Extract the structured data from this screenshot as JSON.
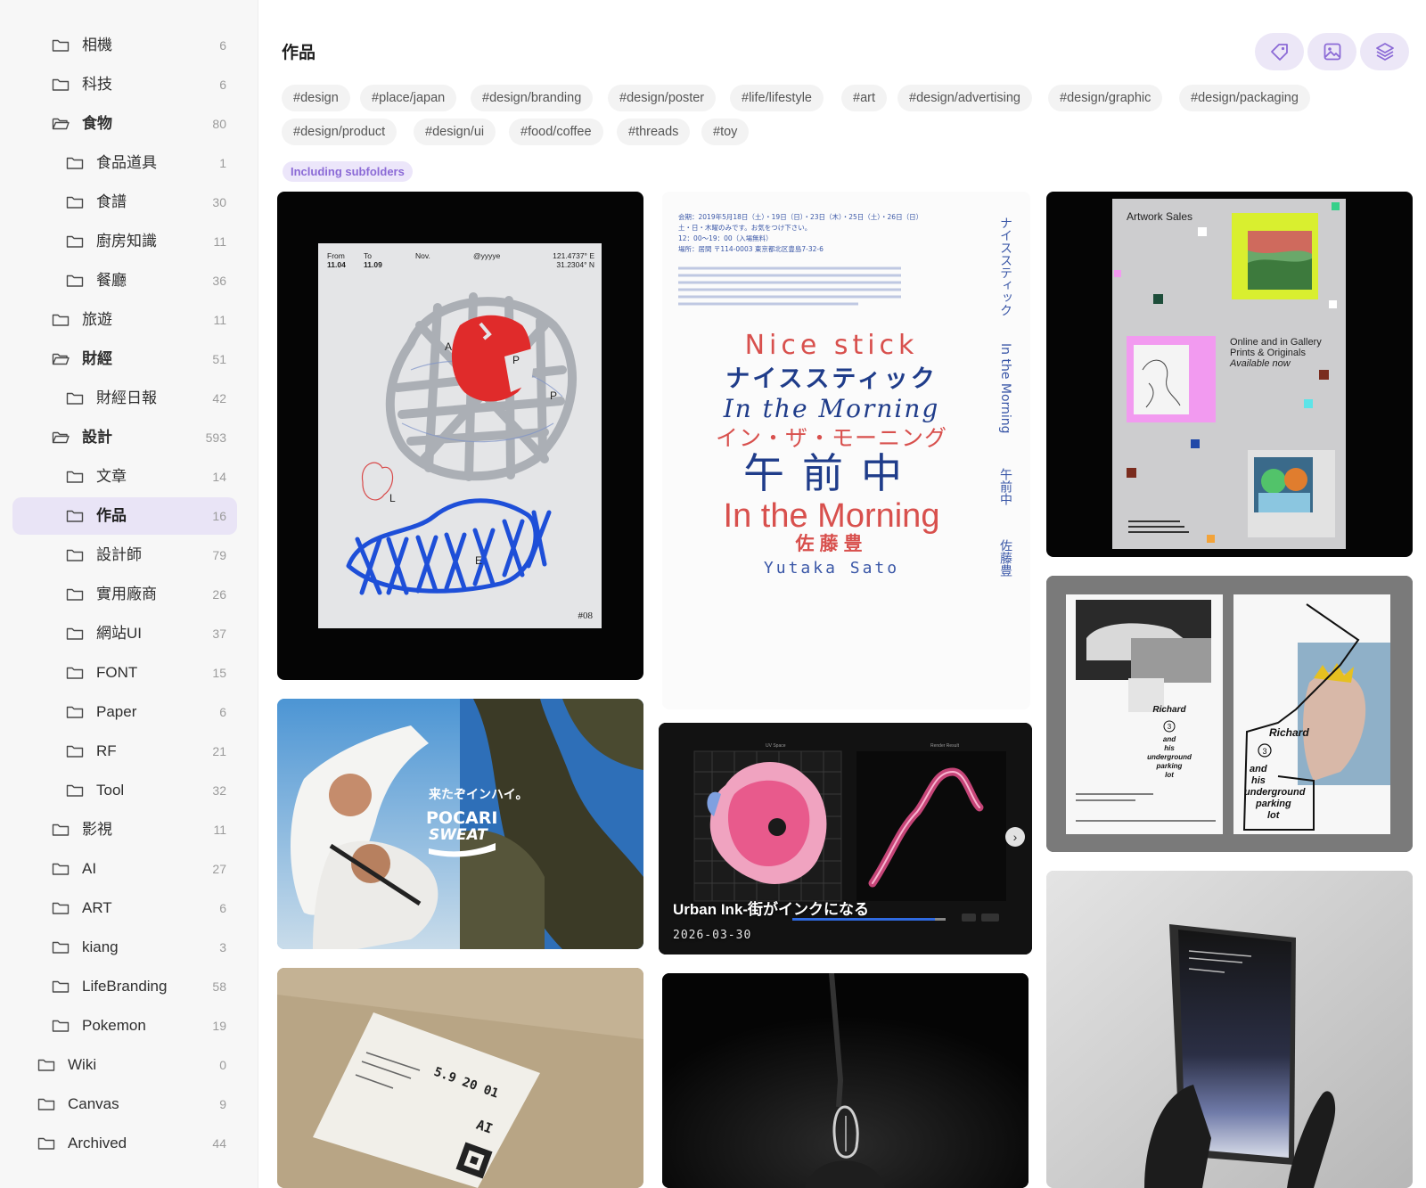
{
  "sidebar": {
    "items": [
      {
        "name": "相機",
        "count": "6",
        "open": false,
        "active": false
      },
      {
        "name": "科技",
        "count": "6",
        "open": false,
        "active": false
      },
      {
        "name": "食物",
        "count": "80",
        "open": true,
        "active": false
      },
      {
        "name": "食品道具",
        "count": "1",
        "open": false,
        "active": false
      },
      {
        "name": "食譜",
        "count": "30",
        "open": false,
        "active": false
      },
      {
        "name": "廚房知識",
        "count": "11",
        "open": false,
        "active": false
      },
      {
        "name": "餐廳",
        "count": "36",
        "open": false,
        "active": false
      },
      {
        "name": "旅遊",
        "count": "11",
        "open": false,
        "active": false
      },
      {
        "name": "財經",
        "count": "51",
        "open": true,
        "active": false
      },
      {
        "name": "財經日報",
        "count": "42",
        "open": false,
        "active": false
      },
      {
        "name": "設計",
        "count": "593",
        "open": true,
        "active": false
      },
      {
        "name": "文章",
        "count": "14",
        "open": false,
        "active": false
      },
      {
        "name": "作品",
        "count": "16",
        "open": false,
        "active": true
      },
      {
        "name": "設計師",
        "count": "79",
        "open": false,
        "active": false
      },
      {
        "name": "實用廠商",
        "count": "26",
        "open": false,
        "active": false
      },
      {
        "name": "網站UI",
        "count": "37",
        "open": false,
        "active": false
      },
      {
        "name": "FONT",
        "count": "15",
        "open": false,
        "active": false
      },
      {
        "name": "Paper",
        "count": "6",
        "open": false,
        "active": false
      },
      {
        "name": "RF",
        "count": "21",
        "open": false,
        "active": false
      },
      {
        "name": "Tool",
        "count": "32",
        "open": false,
        "active": false
      },
      {
        "name": "影視",
        "count": "11",
        "open": false,
        "active": false
      },
      {
        "name": "AI",
        "count": "27",
        "open": false,
        "active": false
      },
      {
        "name": "ART",
        "count": "6",
        "open": false,
        "active": false
      },
      {
        "name": "kiang",
        "count": "3",
        "open": false,
        "active": false
      },
      {
        "name": "LifeBranding",
        "count": "58",
        "open": false,
        "active": false
      },
      {
        "name": "Pokemon",
        "count": "19",
        "open": false,
        "active": false
      },
      {
        "name": "Wiki",
        "count": "0",
        "open": false,
        "active": false
      },
      {
        "name": "Canvas",
        "count": "9",
        "open": false,
        "active": false
      },
      {
        "name": "Archived",
        "count": "44",
        "open": false,
        "active": false
      }
    ]
  },
  "header": {
    "title": "作品",
    "tools": [
      "tag-icon",
      "image-icon",
      "layers-icon"
    ]
  },
  "tags": [
    "#design",
    "#place/japan",
    "#design/branding",
    "#design/poster",
    "#life/lifestyle",
    "#art",
    "#design/advertising",
    "#design/graphic",
    "#design/packaging",
    "#design/product",
    "#design/ui",
    "#food/coffee",
    "#threads",
    "#toy"
  ],
  "filter_badge": "Including subfolders",
  "cards": {
    "apple_poster": {
      "from": "From",
      "from_date": "11.04",
      "to": "To",
      "to_date": "11.09",
      "month": "Nov.",
      "handle": "@yyyye",
      "coord1": "121.4737° E",
      "coord2": "31.2304° N",
      "letters": [
        "A",
        "P",
        "P",
        "L",
        "E"
      ],
      "number": "#08"
    },
    "nice_stick": {
      "info_lines": [
        "会期：2019年5月18日（土）・19日（日）・23日（木）・25日（土）・26日（日）",
        "土・日・木曜のみです。お気をつけ下さい。",
        "12：00〜19：00（入場無料）",
        "場所：居間 〒114-0003 東京都北区豊島7-32-6"
      ],
      "line_en_1": "Nice stick",
      "line_jp_1": "ナイススティック",
      "line_en_2": "In the Morning",
      "line_jp_2": "イン・ザ・モーニング",
      "line_jp_3": "午前中",
      "line_en_3": "In the Morning",
      "author_jp": "佐藤豊",
      "author_en": "Yutaka Sato",
      "vertical_1": "ナイススティック",
      "vertical_2": "In the Morning",
      "vertical_3": "午前中",
      "vertical_4": "佐藤豊"
    },
    "artwork_sales": {
      "title": "Artwork Sales",
      "line1": "Online and in Gallery",
      "line2": "Prints & Originals",
      "line3": "Available now"
    },
    "pocari": {
      "headline": "来たぞインハイ。",
      "brand1": "POCARI",
      "brand2": "SWEAT"
    },
    "urban_ink": {
      "title": "Urban Ink-街がインクになる",
      "date": "2026-03-30",
      "panel_left": "UV Space",
      "panel_right": "Render Result"
    },
    "richard": {
      "name": "Richard",
      "num": "3",
      "line1": "and",
      "line2": "his",
      "line3": "underground",
      "line4": "parking",
      "line5": "lot"
    },
    "ticket": {
      "date_text": "5.9 20 01",
      "code": "AI"
    }
  },
  "colors": {
    "accent": "#8b6ad6",
    "active_bg": "#e9e4f6",
    "poster_red": "#d93a3a",
    "poster_blue": "#1f3c8a"
  }
}
